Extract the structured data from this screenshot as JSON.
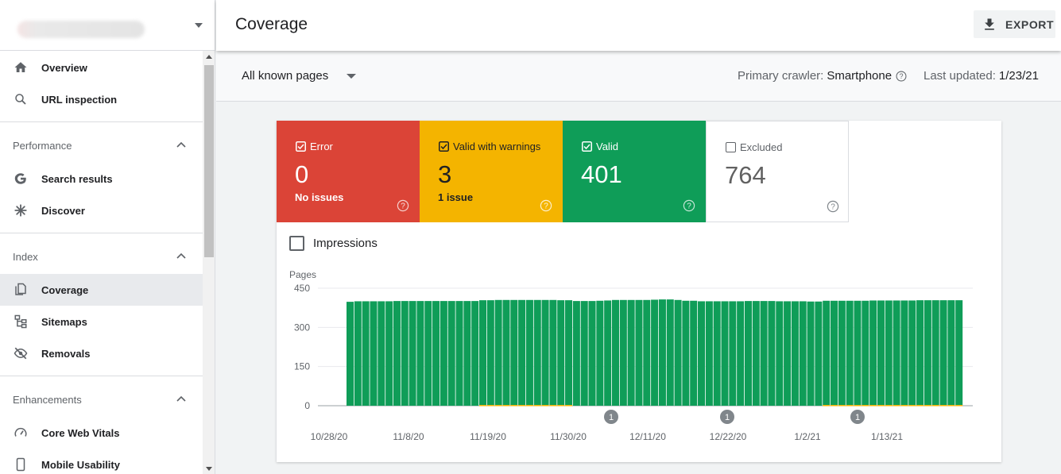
{
  "sidebar": {
    "items": [
      {
        "label": "Overview",
        "icon": "home-icon"
      },
      {
        "label": "URL inspection",
        "icon": "search-icon"
      }
    ],
    "sections": [
      {
        "label": "Performance",
        "items": [
          {
            "label": "Search results",
            "icon": "google-g-icon"
          },
          {
            "label": "Discover",
            "icon": "asterisk-icon"
          }
        ]
      },
      {
        "label": "Index",
        "items": [
          {
            "label": "Coverage",
            "icon": "copy-pages-icon",
            "active": true
          },
          {
            "label": "Sitemaps",
            "icon": "sitemap-icon"
          },
          {
            "label": "Removals",
            "icon": "eye-off-icon"
          }
        ]
      },
      {
        "label": "Enhancements",
        "items": [
          {
            "label": "Core Web Vitals",
            "icon": "gauge-icon"
          },
          {
            "label": "Mobile Usability",
            "icon": "phone-icon"
          }
        ]
      }
    ]
  },
  "header": {
    "title": "Coverage",
    "export_label": "EXPORT"
  },
  "filter": {
    "pages_select": "All known pages",
    "crawler_label": "Primary crawler:",
    "crawler_value": "Smartphone",
    "updated_label": "Last updated:",
    "updated_value": "1/23/21"
  },
  "tiles": {
    "error": {
      "name": "Error",
      "count": "0",
      "issues": "No issues",
      "checked": true,
      "color": "#db4437"
    },
    "warnings": {
      "name": "Valid with warnings",
      "count": "3",
      "issues": "1 issue",
      "checked": true,
      "color": "#f4b400"
    },
    "valid": {
      "name": "Valid",
      "count": "401",
      "issues": "",
      "checked": true,
      "color": "#0f9d58"
    },
    "excluded": {
      "name": "Excluded",
      "count": "764",
      "issues": "",
      "checked": false,
      "color": "#ffffff"
    }
  },
  "impressions_label": "Impressions",
  "chart_data": {
    "type": "bar",
    "ylabel": "Pages",
    "ylim": [
      0,
      450
    ],
    "yticks": [
      0,
      150,
      300,
      450
    ],
    "xtick_labels": [
      "10/28/20",
      "11/8/20",
      "11/19/20",
      "11/30/20",
      "12/11/20",
      "12/22/20",
      "1/2/21",
      "1/13/21"
    ],
    "annotations": [
      "1",
      "1",
      "1"
    ],
    "series": [
      {
        "name": "Valid",
        "color": "#0f9d58",
        "values": [
          398,
          400,
          400,
          400,
          400,
          400,
          401,
          401,
          401,
          401,
          401,
          401,
          401,
          401,
          401,
          401,
          401,
          401,
          401,
          402,
          402,
          402,
          402,
          402,
          402,
          402,
          402,
          401,
          401,
          401,
          401,
          401,
          402,
          403,
          405,
          405,
          405,
          405,
          405,
          406,
          407,
          407,
          405,
          402,
          402,
          400,
          400,
          400,
          400,
          400,
          400,
          401,
          401,
          401,
          401,
          400,
          400,
          400,
          400,
          399,
          399,
          399,
          399,
          399,
          399,
          399,
          399,
          400,
          400,
          400,
          400,
          400,
          400,
          401,
          401,
          401,
          401,
          401,
          401
        ]
      },
      {
        "name": "Valid with warnings",
        "color": "#f4b400",
        "values": [
          0,
          0,
          0,
          0,
          0,
          0,
          0,
          0,
          0,
          0,
          0,
          0,
          0,
          0,
          0,
          0,
          0,
          3,
          3,
          3,
          3,
          3,
          3,
          3,
          3,
          3,
          3,
          3,
          3,
          0,
          0,
          0,
          0,
          0,
          0,
          0,
          0,
          0,
          0,
          0,
          0,
          0,
          0,
          0,
          0,
          0,
          0,
          0,
          0,
          0,
          0,
          0,
          0,
          0,
          0,
          0,
          0,
          0,
          0,
          0,
          0,
          3,
          3,
          3,
          3,
          3,
          3,
          3,
          3,
          3,
          3,
          3,
          3,
          3,
          3,
          3,
          3,
          3,
          3
        ]
      },
      {
        "name": "Error",
        "color": "#db4437",
        "values": [
          0,
          0,
          0,
          0,
          0,
          0,
          0,
          0,
          0,
          0,
          0,
          0,
          0,
          0,
          0,
          0,
          0,
          0,
          0,
          0,
          0,
          0,
          0,
          0,
          0,
          0,
          0,
          0,
          0,
          0,
          0,
          0,
          0,
          0,
          0,
          0,
          0,
          0,
          0,
          0,
          0,
          0,
          0,
          0,
          0,
          0,
          0,
          0,
          0,
          0,
          0,
          0,
          0,
          0,
          0,
          0,
          0,
          0,
          0,
          0,
          0,
          0,
          0,
          0,
          0,
          0,
          0,
          0,
          0,
          0,
          0,
          0,
          0,
          0,
          0,
          0,
          0,
          0,
          0
        ]
      }
    ]
  }
}
